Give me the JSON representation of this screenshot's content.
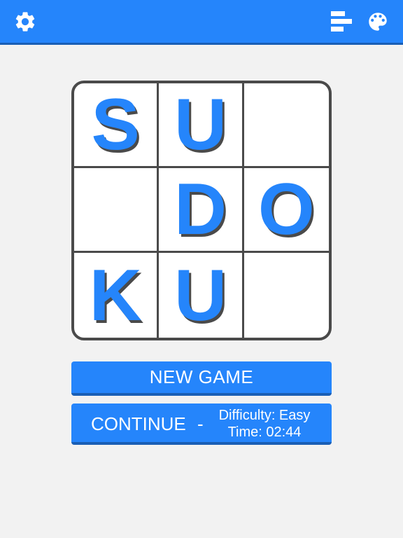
{
  "header": {
    "icons": {
      "settings": "gear-icon",
      "stats": "bar-chart-icon",
      "theme": "palette-icon"
    },
    "background_color": "#2585fb"
  },
  "board": {
    "cells": [
      "S",
      "U",
      "",
      "",
      "D",
      "O",
      "K",
      "U",
      ""
    ],
    "letter_color": "#2585fb",
    "shadow_color": "#4a4a4a"
  },
  "menu": {
    "new_game_label": "NEW GAME",
    "continue_label": "CONTINUE",
    "continue_separator": "-",
    "difficulty_text": "Difficulty: Easy",
    "time_text": "Time: 02:44"
  }
}
